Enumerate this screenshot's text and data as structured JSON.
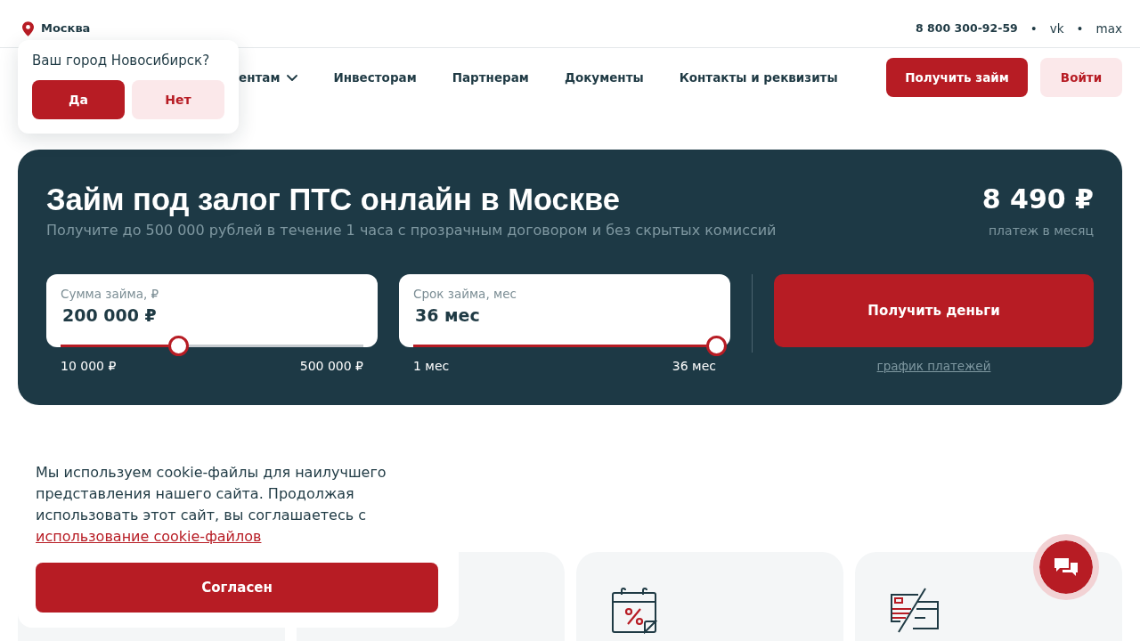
{
  "top_bar": {
    "city": "Москва",
    "contacts": [
      {
        "kind": "phone",
        "text": "8 800 300-92-59"
      },
      {
        "kind": "separator",
        "text": "•"
      },
      {
        "kind": "link",
        "text": "vk"
      },
      {
        "kind": "separator",
        "text": "•"
      },
      {
        "kind": "link",
        "text": "max"
      }
    ]
  },
  "city_prompt": {
    "question": "Ваш город Новосибирск?",
    "buttons": [
      {
        "label": "Да",
        "kind": "primary"
      },
      {
        "label": "Нет",
        "kind": "secondary"
      }
    ]
  },
  "nav": {
    "items": [
      {
        "label": "ентам",
        "dropdown": true
      },
      {
        "label": "Инвесторам",
        "dropdown": false
      },
      {
        "label": "Партнерам",
        "dropdown": false
      },
      {
        "label": "Документы",
        "dropdown": false
      },
      {
        "label": "Контакты и реквизиты",
        "dropdown": false
      }
    ],
    "buttons": [
      {
        "label": "Получить займ",
        "kind": "primary"
      },
      {
        "label": "Войти",
        "kind": "secondary"
      }
    ]
  },
  "hero": {
    "title": "Займ под залог ПТС онлайн в Москве",
    "subtitle": "Получите до 500 000 рублей в течение 1 часа с прозрачным договором и без скрытых комиссий",
    "payment": {
      "amount": "8 490 ₽",
      "caption": "платеж в месяц"
    },
    "sliders": [
      {
        "label": "Сумма займа, ₽",
        "value": "200 000 ₽",
        "level": 0.39,
        "min_label": "10 000 ₽",
        "max_label": "500 000 ₽"
      },
      {
        "label": "Срок займа, мес",
        "value": "36 мес",
        "level": 1,
        "min_label": "1 мес",
        "max_label": "36 мес"
      }
    ],
    "submit": "Получить деньги",
    "schedule_link": "график платежей"
  },
  "cookie_banner": {
    "text": "Мы используем cookie-файлы для наилучшего представления нашего сайта. Продолжая использовать этот сайт, вы соглашаетесь с",
    "link": "использование cookie-файлов",
    "button": "Согласен"
  }
}
